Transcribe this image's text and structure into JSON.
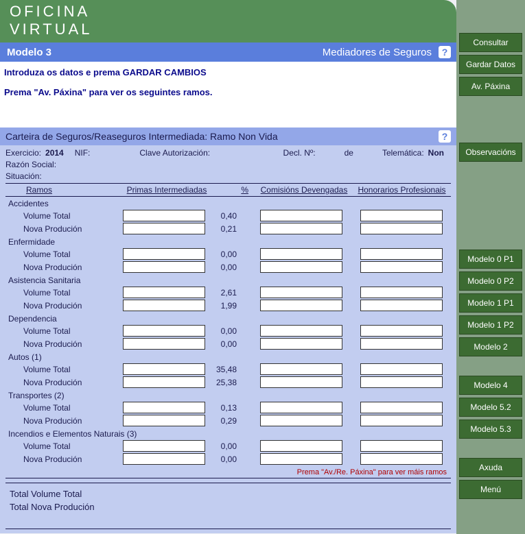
{
  "brand": {
    "line1": "OFICINA",
    "line2": "VIRTUAL"
  },
  "titlebar": {
    "left": "Modelo 3",
    "right": "Mediadores de Seguros",
    "help": "?"
  },
  "instructions": {
    "line1": "Introduza os datos e prema GARDAR CAMBIOS",
    "line2": "Prema \"Av. Páxina\" para ver os seguintes ramos."
  },
  "section": {
    "title": "Carteira de Seguros/Reaseguros Intermediada: Ramo Non Vida",
    "help": "?"
  },
  "meta": {
    "exercicio_label": "Exercicio:",
    "exercicio_value": "2014",
    "nif_label": "NIF:",
    "clave_label": "Clave Autorización:",
    "decl_label": "Decl. Nº:",
    "de_label": "de",
    "telematica_label": "Telemática:",
    "telematica_value": "Non",
    "razon_label": "Razón Social:",
    "situacion_label": "Situación:"
  },
  "columns": {
    "ramos": "Ramos",
    "primas": "Primas Intermediadas",
    "pct": "%",
    "comis": "Comisións Devengadas",
    "honor": "Honorarios Profesionais"
  },
  "row_labels": {
    "volume": "Volume Total",
    "nova": "Nova Produción"
  },
  "groups": [
    {
      "name": "Accidentes",
      "volume_pct": "0,40",
      "nova_pct": "0,21"
    },
    {
      "name": "Enfermidade",
      "volume_pct": "0,00",
      "nova_pct": "0,00"
    },
    {
      "name": "Asistencia Sanitaria",
      "volume_pct": "2,61",
      "nova_pct": "1,99"
    },
    {
      "name": "Dependencia",
      "volume_pct": "0,00",
      "nova_pct": "0,00"
    },
    {
      "name": "Autos (1)",
      "volume_pct": "35,48",
      "nova_pct": "25,38"
    },
    {
      "name": "Transportes (2)",
      "volume_pct": "0,13",
      "nova_pct": "0,29"
    },
    {
      "name": "Incendios e Elementos Naturais (3)",
      "volume_pct": "0,00",
      "nova_pct": "0,00"
    }
  ],
  "footer_hint": "Prema \"Av./Re. Páxina\" para ver máis ramos",
  "totals": {
    "volume": "Total Volume Total",
    "nova": "Total Nova Produción"
  },
  "sidebar": {
    "consultar": "Consultar",
    "gardar": "Gardar Datos",
    "av_paxina": "Av. Páxina",
    "observacions": "Observacións",
    "modelo0p1": "Modelo 0 P1",
    "modelo0p2": "Modelo 0 P2",
    "modelo1p1": "Modelo 1 P1",
    "modelo1p2": "Modelo 1 P2",
    "modelo2": "Modelo 2",
    "modelo4": "Modelo 4",
    "modelo52": "Modelo 5.2",
    "modelo53": "Modelo 5.3",
    "axuda": "Axuda",
    "menu": "Menú"
  }
}
